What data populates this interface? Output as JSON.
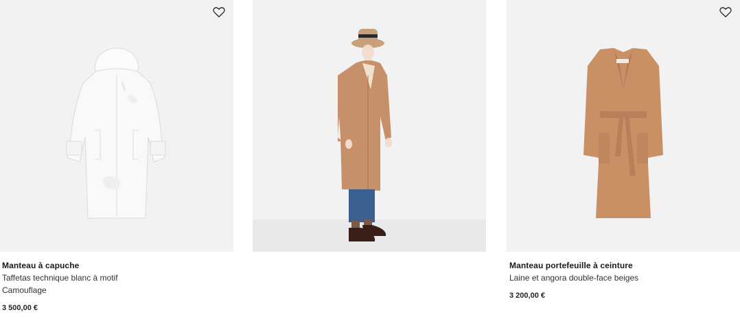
{
  "colors": {
    "tile_bg": "#f2f2f2",
    "camel": "#c99066",
    "white_coat": "#f8f8f8"
  },
  "products": [
    {
      "name": "Manteau à capuche",
      "description_lines": [
        "Taffetas technique blanc à motif",
        "Camouflage"
      ],
      "price": "3 500,00 €",
      "wishlist_icon": "heart-outline-icon",
      "image": "white-hooded-parka"
    },
    {
      "image": "model-in-camel-coat-with-hat"
    },
    {
      "name": "Manteau portefeuille à ceinture",
      "description_lines": [
        "Laine et angora double-face beiges"
      ],
      "price": "3 200,00 €",
      "wishlist_icon": "heart-outline-icon",
      "image": "camel-belted-wrap-coat"
    }
  ]
}
